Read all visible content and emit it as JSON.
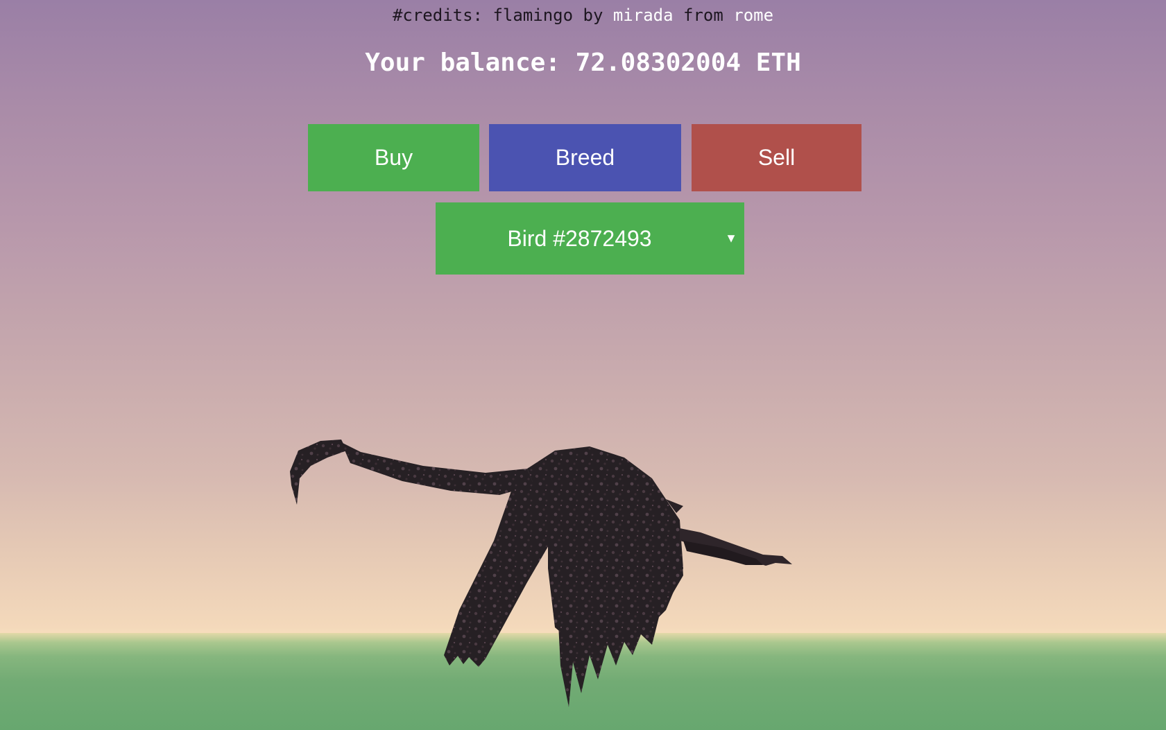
{
  "header": {
    "credits_prefix": "#credits: flamingo by ",
    "credits_author": "mirada",
    "credits_mid": " from ",
    "credits_place": "rome",
    "balance": "Your balance: 72.08302004 ETH"
  },
  "actions": {
    "buy_label": "Buy",
    "breed_label": "Breed",
    "sell_label": "Sell"
  },
  "bird_select": {
    "selected": "Bird #2872493",
    "caret": "▼"
  },
  "colors": {
    "buy": "#4caf50",
    "breed": "#4b53b1",
    "sell": "#b0504b",
    "select": "#4caf50",
    "bird_body": "#2a2226"
  }
}
